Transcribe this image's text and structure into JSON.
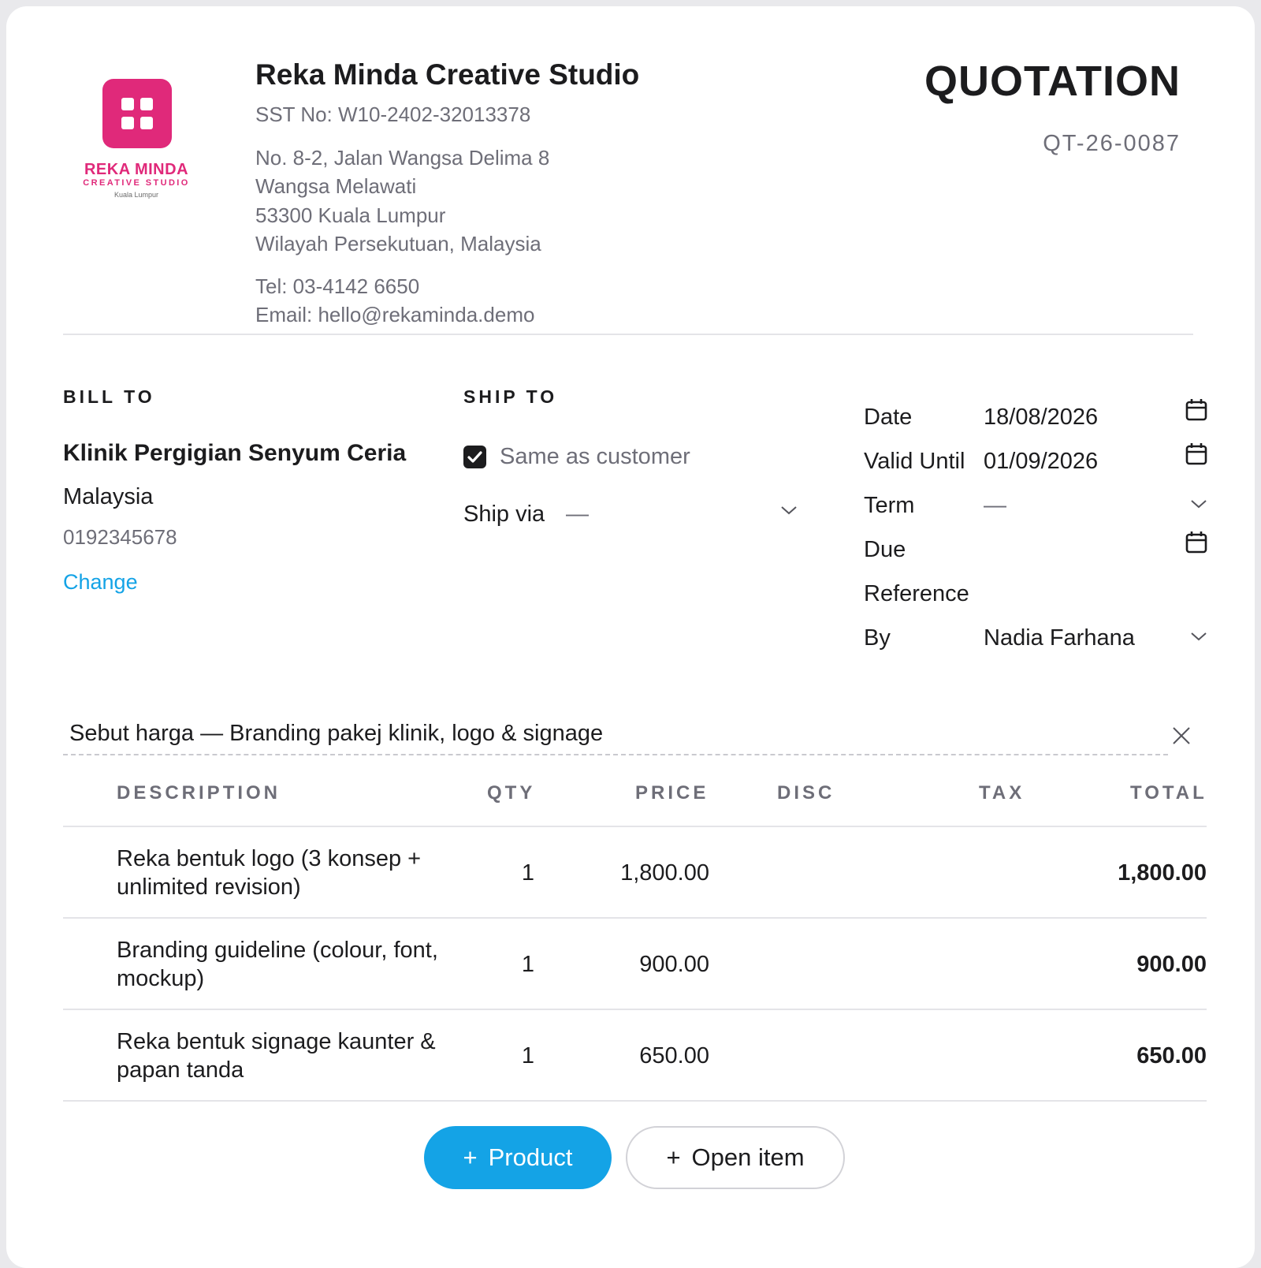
{
  "company": {
    "logo_name": "REKA MINDA",
    "logo_sub": "CREATIVE STUDIO",
    "logo_city": "Kuala Lumpur",
    "name": "Reka Minda Creative Studio",
    "sst": "SST No: W10-2402-32013378",
    "address": [
      "No. 8-2, Jalan Wangsa Delima 8",
      "Wangsa Melawati",
      "53300 Kuala Lumpur",
      "Wilayah Persekutuan, Malaysia"
    ],
    "tel": "Tel: 03-4142 6650",
    "email": "Email: hello@rekaminda.demo",
    "brand_color": "#e0297a"
  },
  "document": {
    "title": "QUOTATION",
    "number": "QT-26-0087"
  },
  "bill_to": {
    "label": "BILL TO",
    "name": "Klinik Pergigian Senyum Ceria",
    "country": "Malaysia",
    "phone": "0192345678",
    "change_label": "Change"
  },
  "ship_to": {
    "label": "SHIP TO",
    "same_as_customer_label": "Same as customer",
    "same_as_customer": true,
    "ship_via_label": "Ship via",
    "ship_via_value": "—"
  },
  "fields": {
    "date_label": "Date",
    "date_value": "18/08/2026",
    "valid_label": "Valid Until",
    "valid_value": "01/09/2026",
    "term_label": "Term",
    "term_value": "—",
    "due_label": "Due",
    "due_value": "",
    "reference_label": "Reference",
    "reference_value": "",
    "by_label": "By",
    "by_value": "Nadia Farhana"
  },
  "quote_title": "Sebut harga — Branding pakej klinik, logo & signage",
  "table": {
    "headers": {
      "description": "DESCRIPTION",
      "qty": "QTY",
      "price": "PRICE",
      "disc": "DISC",
      "tax": "TAX",
      "total": "TOTAL"
    },
    "rows": [
      {
        "description": "Reka bentuk logo (3 konsep + unlimited revision)",
        "qty": "1",
        "price": "1,800.00",
        "disc": "",
        "tax": "",
        "total": "1,800.00"
      },
      {
        "description": "Branding guideline (colour, font, mockup)",
        "qty": "1",
        "price": "900.00",
        "disc": "",
        "tax": "",
        "total": "900.00"
      },
      {
        "description": "Reka bentuk signage kaunter & papan tanda",
        "qty": "1",
        "price": "650.00",
        "disc": "",
        "tax": "",
        "total": "650.00"
      }
    ]
  },
  "actions": {
    "product_label": "Product",
    "open_item_label": "Open item",
    "accent_color": "#14a3e6"
  }
}
